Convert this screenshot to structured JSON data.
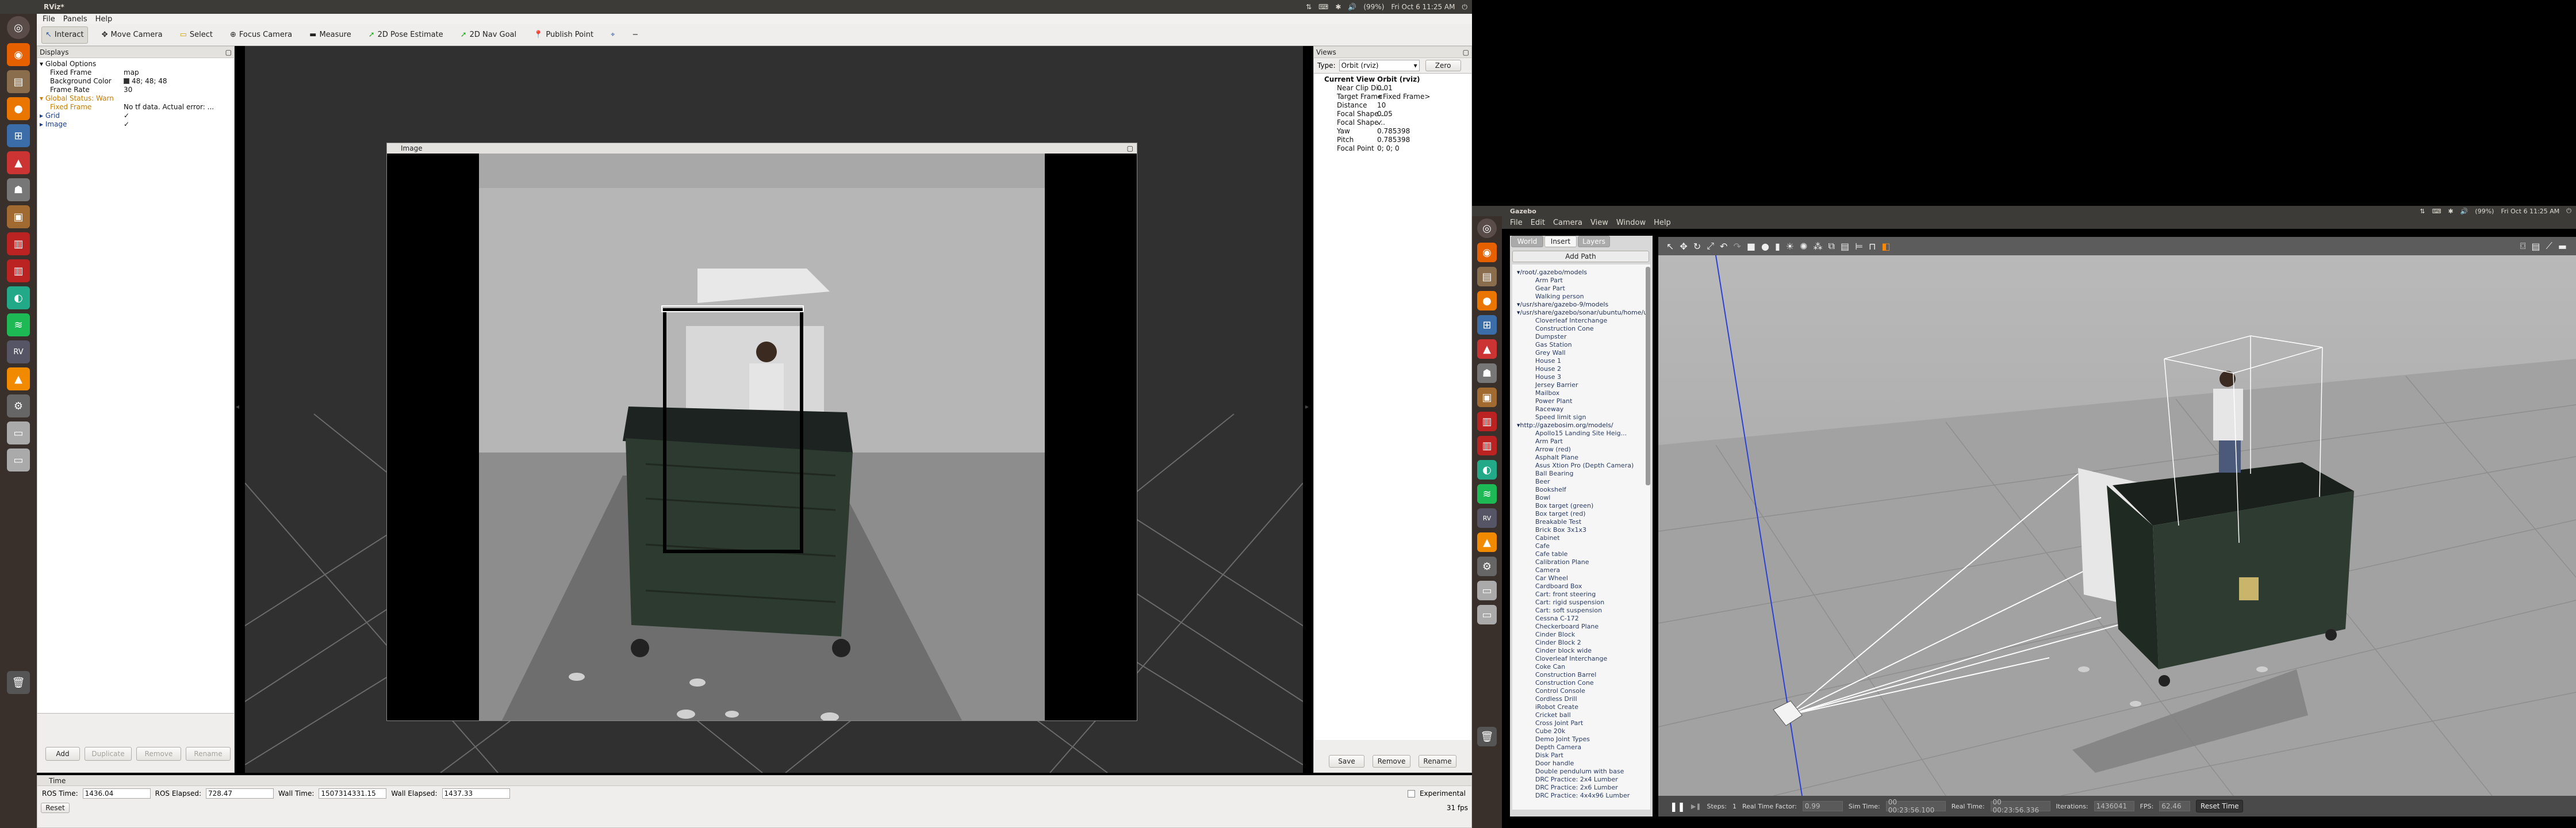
{
  "left_screen": {
    "system_bar": {
      "app_title": "RViz*",
      "tray": {
        "sound": "🔊",
        "battery": "(99%)",
        "clock": "Fri Oct  6 11:25 AM",
        "power": "⏻"
      }
    },
    "menu": [
      "File",
      "Panels",
      "Help"
    ],
    "toolbar": [
      {
        "label": "Interact",
        "icon": "interact-icon",
        "selected": true
      },
      {
        "label": "Move Camera",
        "icon": "move-camera-icon"
      },
      {
        "label": "Select",
        "icon": "select-icon"
      },
      {
        "label": "Focus Camera",
        "icon": "focus-camera-icon"
      },
      {
        "label": "Measure",
        "icon": "measure-icon"
      },
      {
        "label": "2D Pose Estimate",
        "icon": "pose-arrow-icon"
      },
      {
        "label": "2D Nav Goal",
        "icon": "nav-goal-arrow-icon"
      },
      {
        "label": "Publish Point",
        "icon": "publish-point-icon"
      }
    ],
    "toolbar_extra": {
      "crosshair": "⌖",
      "minus": "−"
    },
    "displays": {
      "title": "Displays",
      "rows": [
        {
          "name": "Global Options",
          "value": "",
          "level": 0,
          "expand": "▾"
        },
        {
          "name": "Fixed Frame",
          "value": "map",
          "level": 1
        },
        {
          "name": "Background Color",
          "value": "48; 48; 48",
          "level": 1,
          "swatch": "#303030"
        },
        {
          "name": "Frame Rate",
          "value": "30",
          "level": 1
        },
        {
          "name": "Global Status: Warn",
          "value": "",
          "level": 0,
          "expand": "▾",
          "status": "warn"
        },
        {
          "name": "Fixed Frame",
          "value": "No tf data.  Actual error: ...",
          "level": 1,
          "status": "warn"
        },
        {
          "name": "Grid",
          "value": "✓",
          "level": 0,
          "expand": "▸"
        },
        {
          "name": "Image",
          "value": "✓",
          "level": 0,
          "expand": "▸"
        }
      ],
      "buttons": [
        {
          "label": "Add",
          "enabled": true
        },
        {
          "label": "Duplicate",
          "enabled": false
        },
        {
          "label": "Remove",
          "enabled": false
        },
        {
          "label": "Rename",
          "enabled": false
        }
      ]
    },
    "image_window": {
      "title": "Image"
    },
    "views": {
      "title": "Views",
      "type_label": "Type:",
      "type_value": "Orbit (rviz)",
      "zero_label": "Zero",
      "current_view": {
        "name": "Current View",
        "value": "Orbit (rviz)"
      },
      "rows": [
        {
          "name": "Near Clip Di...",
          "value": "0.01"
        },
        {
          "name": "Target Frame",
          "value": "<Fixed Frame>"
        },
        {
          "name": "Distance",
          "value": "10"
        },
        {
          "name": "Focal Shape...",
          "value": "0.05"
        },
        {
          "name": "Focal Shape...",
          "value": "✓"
        },
        {
          "name": "Yaw",
          "value": "0.785398"
        },
        {
          "name": "Pitch",
          "value": "0.785398"
        },
        {
          "name": "Focal Point",
          "value": "0; 0; 0"
        }
      ],
      "buttons": [
        "Save",
        "Remove",
        "Rename"
      ]
    },
    "time_panel": {
      "title": "Time",
      "ros_time_label": "ROS Time:",
      "ros_time": "1436.04",
      "ros_elapsed_label": "ROS Elapsed:",
      "ros_elapsed": "728.47",
      "wall_time_label": "Wall Time:",
      "wall_time": "1507314331.15",
      "wall_elapsed_label": "Wall Elapsed:",
      "wall_elapsed": "1437.33",
      "experimental_label": "Experimental",
      "reset_label": "Reset",
      "fps": "31 fps"
    }
  },
  "right_screen": {
    "system_bar": {
      "app_title": "Gazebo",
      "clock": "Fri Oct  6 11:25 AM",
      "battery": "(99%)"
    },
    "menu": [
      "File",
      "Edit",
      "Camera",
      "View",
      "Window",
      "Help"
    ],
    "tabs": [
      {
        "label": "World",
        "active": false
      },
      {
        "label": "Insert",
        "active": true
      },
      {
        "label": "Layers",
        "active": false
      }
    ],
    "add_path": "Add Path",
    "model_paths": [
      {
        "text": "/root/.gazebo/models",
        "hdr": true
      },
      {
        "text": "Arm Part"
      },
      {
        "text": "Gear Part"
      },
      {
        "text": "Walking person"
      },
      {
        "text": "/usr/share/gazebo-9/models",
        "hdr": true
      },
      {
        "text": "/usr/share/gazebo/sonar/ubuntu/home/user/.ca...",
        "hdr": true
      },
      {
        "text": "Cloverleaf Interchange"
      },
      {
        "text": "Construction Cone"
      },
      {
        "text": "Dumpster"
      },
      {
        "text": "Gas Station"
      },
      {
        "text": "Grey Wall"
      },
      {
        "text": "House 1"
      },
      {
        "text": "House 2"
      },
      {
        "text": "House 3"
      },
      {
        "text": "Jersey Barrier"
      },
      {
        "text": "Mailbox"
      },
      {
        "text": "Power Plant"
      },
      {
        "text": "Raceway"
      },
      {
        "text": "Speed limit sign"
      },
      {
        "text": "http://gazebosim.org/models/",
        "hdr": true
      },
      {
        "text": "Apollo15 Landing Site Heig..."
      },
      {
        "text": "Arm Part"
      },
      {
        "text": "Arrow (red)"
      },
      {
        "text": "Asphalt Plane"
      },
      {
        "text": "Asus Xtion Pro (Depth Camera)"
      },
      {
        "text": "Ball Bearing"
      },
      {
        "text": "Beer"
      },
      {
        "text": "Bookshelf"
      },
      {
        "text": "Bowl"
      },
      {
        "text": "Box target (green)"
      },
      {
        "text": "Box target (red)"
      },
      {
        "text": "Breakable Test"
      },
      {
        "text": "Brick Box 3x1x3"
      },
      {
        "text": "Cabinet"
      },
      {
        "text": "Cafe"
      },
      {
        "text": "Cafe table"
      },
      {
        "text": "Calibration Plane"
      },
      {
        "text": "Camera"
      },
      {
        "text": "Car Wheel"
      },
      {
        "text": "Cardboard Box"
      },
      {
        "text": "Cart: front steering"
      },
      {
        "text": "Cart: rigid suspension"
      },
      {
        "text": "Cart: soft suspension"
      },
      {
        "text": "Cessna C-172"
      },
      {
        "text": "Checkerboard Plane"
      },
      {
        "text": "Cinder Block"
      },
      {
        "text": "Cinder Block 2"
      },
      {
        "text": "Cinder block wide"
      },
      {
        "text": "Cloverleaf Interchange"
      },
      {
        "text": "Coke Can"
      },
      {
        "text": "Construction Barrel"
      },
      {
        "text": "Construction Cone"
      },
      {
        "text": "Control Console"
      },
      {
        "text": "Cordless Drill"
      },
      {
        "text": "iRobot Create"
      },
      {
        "text": "Cricket ball"
      },
      {
        "text": "Cross Joint Part"
      },
      {
        "text": "Cube 20k"
      },
      {
        "text": "Demo Joint Types"
      },
      {
        "text": "Depth Camera"
      },
      {
        "text": "Disk Part"
      },
      {
        "text": "Door handle"
      },
      {
        "text": "Double pendulum with base"
      },
      {
        "text": "DRC Practice: 2x4 Lumber"
      },
      {
        "text": "DRC Practice: 2x6 Lumber"
      },
      {
        "text": "DRC Practice: 4x4x96 Lumber"
      }
    ],
    "bottom_bar": {
      "steps_label": "Steps:",
      "steps_value": "1",
      "rtf_label": "Real Time Factor:",
      "rtf_value": "0.99",
      "sim_time_label": "Sim Time:",
      "sim_time_value": "00 00:23:56.100",
      "real_time_label": "Real Time:",
      "real_time_value": "00 00:23:56.336",
      "iter_label": "Iterations:",
      "iter_value": "1436041",
      "fps_label": "FPS:",
      "fps_value": "62.46",
      "reset_label": "Reset Time"
    }
  }
}
